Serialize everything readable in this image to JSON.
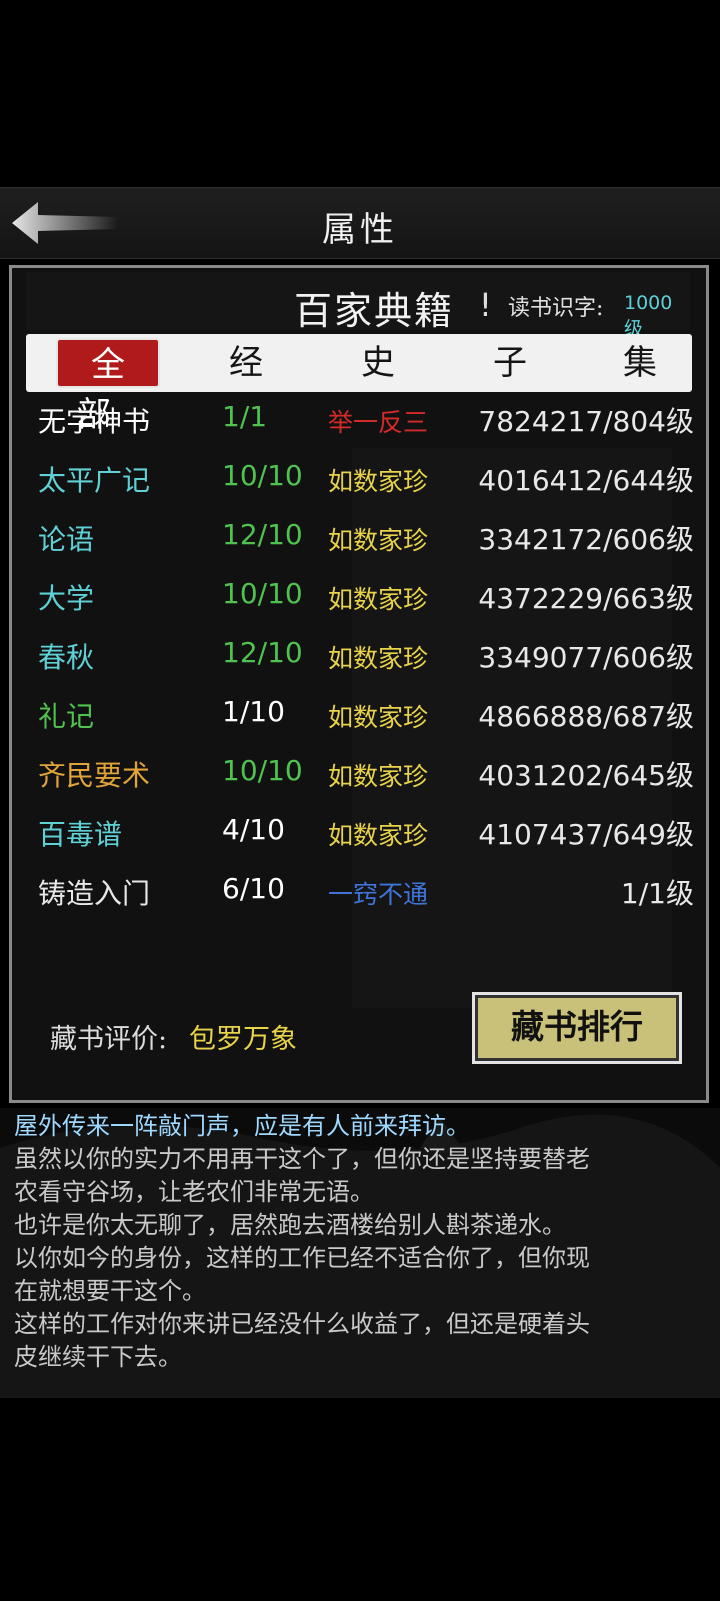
{
  "header": {
    "title": "属性"
  },
  "panel": {
    "title": "百家典籍",
    "alert": "!",
    "literacy_label": "读书识字:",
    "literacy_value": "1000级",
    "tabs": [
      "全部",
      "经",
      "史",
      "子",
      "集"
    ],
    "active_tab": 0,
    "books": [
      {
        "name": "无字神书",
        "progress": "1/1",
        "grade": "举一反三",
        "exp": "7824217/804级",
        "name_color": "#ffffff",
        "prog_color": "#4fc24f",
        "grade_color": "#d42a2a"
      },
      {
        "name": "太平广记",
        "progress": "10/10",
        "grade": "如数家珍",
        "exp": "4016412/644级",
        "name_color": "#5fd0d6",
        "prog_color": "#4fc24f",
        "grade_color": "#e8d34a"
      },
      {
        "name": "论语",
        "progress": "12/10",
        "grade": "如数家珍",
        "exp": "3342172/606级",
        "name_color": "#5fd0d6",
        "prog_color": "#4fc24f",
        "grade_color": "#e8d34a"
      },
      {
        "name": "大学",
        "progress": "10/10",
        "grade": "如数家珍",
        "exp": "4372229/663级",
        "name_color": "#5fd0d6",
        "prog_color": "#4fc24f",
        "grade_color": "#e8d34a"
      },
      {
        "name": "春秋",
        "progress": "12/10",
        "grade": "如数家珍",
        "exp": "3349077/606级",
        "name_color": "#5fd0d6",
        "prog_color": "#4fc24f",
        "grade_color": "#e8d34a"
      },
      {
        "name": "礼记",
        "progress": "1/10",
        "grade": "如数家珍",
        "exp": "4866888/687级",
        "name_color": "#4fc24f",
        "prog_color": "#ffffff",
        "grade_color": "#e8d34a"
      },
      {
        "name": "齐民要术",
        "progress": "10/10",
        "grade": "如数家珍",
        "exp": "4031202/645级",
        "name_color": "#e0a43a",
        "prog_color": "#4fc24f",
        "grade_color": "#e8d34a"
      },
      {
        "name": "百毒谱",
        "progress": "4/10",
        "grade": "如数家珍",
        "exp": "4107437/649级",
        "name_color": "#5fd0d6",
        "prog_color": "#ffffff",
        "grade_color": "#e8d34a"
      },
      {
        "name": "铸造入门",
        "progress": "6/10",
        "grade": "一窍不通",
        "exp": "1/1级",
        "name_color": "#e8e8e8",
        "prog_color": "#ffffff",
        "grade_color": "#3f74d9"
      }
    ],
    "rating_label": "藏书评价:",
    "rating_value": "包罗万象",
    "rank_button": "藏书排行"
  },
  "log": [
    "屋外传来一阵敲门声，应是有人前来拜访。",
    "虽然以你的实力不用再干这个了，但你还是坚持要替老",
    "农看守谷场，让老农们非常无语。",
    "也许是你太无聊了，居然跑去酒楼给别人斟茶递水。",
    "以你如今的身份，这样的工作已经不适合你了，但你现",
    "在就想要干这个。",
    "这样的工作对你来讲已经没什么收益了，但还是硬着头",
    "皮继续干下去。"
  ]
}
